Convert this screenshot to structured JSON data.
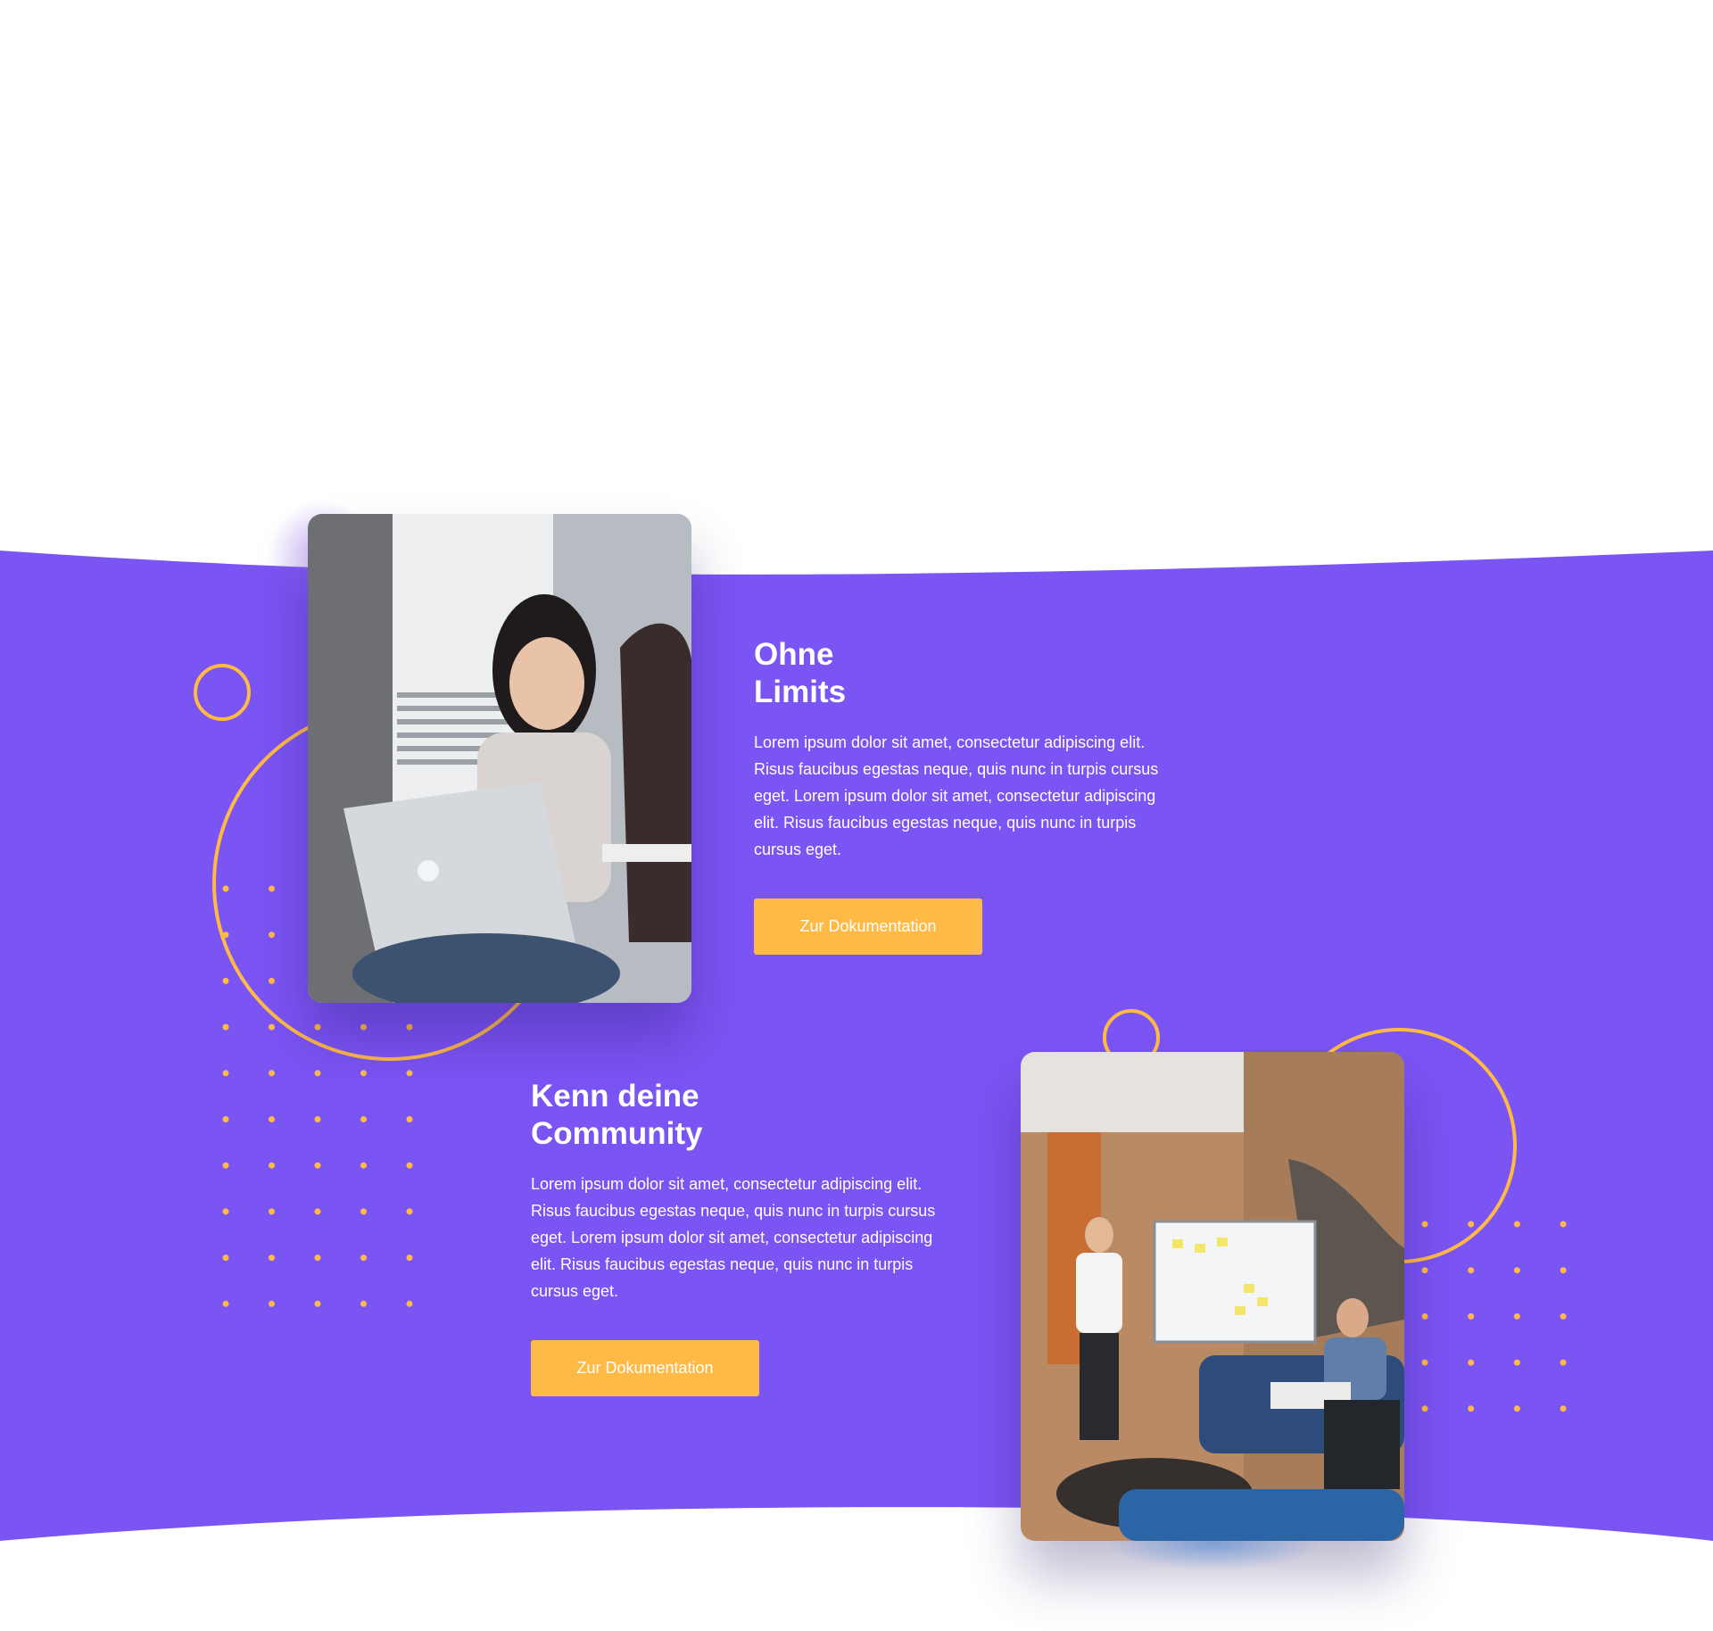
{
  "colors": {
    "band": "#7b54f4",
    "accent": "#ffba45",
    "text_on_band": "#ffffff"
  },
  "features": [
    {
      "title_lines": [
        "Ohne",
        "Limits"
      ],
      "body": "Lorem ipsum dolor sit amet, consectetur adipiscing elit. Risus faucibus egestas neque, quis nunc in turpis cursus eget. Lorem ipsum dolor sit amet, consectetur adipiscing elit. Risus faucibus egestas neque, quis nunc in turpis cursus eget.",
      "button_label": "Zur Dokumentation",
      "image": "women-with-laptop-photo"
    },
    {
      "title_lines": [
        "Kenn deine",
        "Community"
      ],
      "body": "Lorem ipsum dolor sit amet, consectetur adipiscing elit. Risus faucibus egestas neque, quis nunc in turpis cursus eget. Lorem ipsum dolor sit amet, consectetur adipiscing elit. Risus faucibus egestas neque, quis nunc in turpis cursus eget.",
      "button_label": "Zur Dokumentation",
      "image": "team-whiteboard-meeting-photo"
    }
  ]
}
